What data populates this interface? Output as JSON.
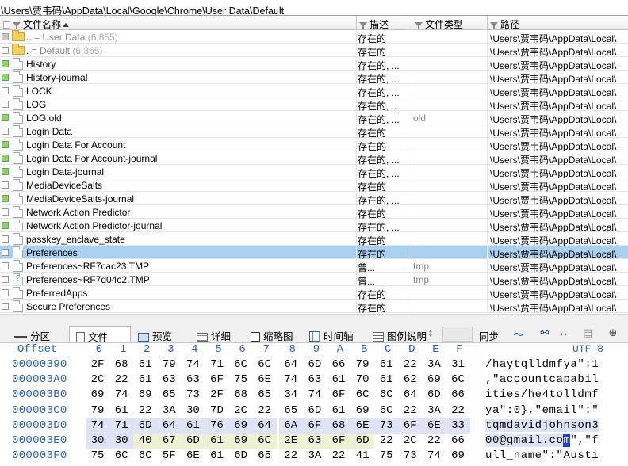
{
  "path_bar": "\\Users\\贾韦码\\AppData\\Local\\Google\\Chrome\\User Data\\Default",
  "columns": {
    "name": "文件名称",
    "desc": "描述",
    "type": "文件类型",
    "path": "路径"
  },
  "files": [
    {
      "name": "..",
      "extra": " =   User Data",
      "count": "(6,855)",
      "desc": "存在的",
      "type": "",
      "path": "\\Users\\贾韦码\\AppData\\Local\\",
      "icon": "folder",
      "mark": "gray",
      "dim": true,
      "selected": false
    },
    {
      "name": ".",
      "extra": "  =   Default",
      "count": "(6,365)",
      "desc": "存在的",
      "type": "",
      "path": "\\Users\\贾韦码\\AppData\\Local\\",
      "icon": "folder",
      "mark": "none",
      "dim": true,
      "selected": false
    },
    {
      "name": "History",
      "extra": "",
      "count": "",
      "desc": "存在的, ...",
      "type": "",
      "path": "\\Users\\贾韦码\\AppData\\Local\\",
      "icon": "file",
      "mark": "green",
      "dim": false,
      "selected": false
    },
    {
      "name": "History-journal",
      "extra": "",
      "count": "",
      "desc": "存在的, ...",
      "type": "",
      "path": "\\Users\\贾韦码\\AppData\\Local\\",
      "icon": "file",
      "mark": "green",
      "dim": false,
      "selected": false
    },
    {
      "name": "LOCK",
      "extra": "",
      "count": "",
      "desc": "存在的, ...",
      "type": "",
      "path": "\\Users\\贾韦码\\AppData\\Local\\",
      "icon": "file",
      "mark": "none",
      "dim": false,
      "selected": false
    },
    {
      "name": "LOG",
      "extra": "",
      "count": "",
      "desc": "存在的, ...",
      "type": "",
      "path": "\\Users\\贾韦码\\AppData\\Local\\",
      "icon": "file",
      "mark": "none",
      "dim": false,
      "selected": false
    },
    {
      "name": "LOG.old",
      "extra": "",
      "count": "",
      "desc": "存在的, ...",
      "type": "old",
      "path": "\\Users\\贾韦码\\AppData\\Local\\",
      "icon": "file",
      "mark": "green",
      "dim": false,
      "selected": false
    },
    {
      "name": "Login Data",
      "extra": "",
      "count": "",
      "desc": "存在的",
      "type": "",
      "path": "\\Users\\贾韦码\\AppData\\Local\\",
      "icon": "file",
      "mark": "none",
      "dim": false,
      "selected": false
    },
    {
      "name": "Login Data For Account",
      "extra": "",
      "count": "",
      "desc": "存在的",
      "type": "",
      "path": "\\Users\\贾韦码\\AppData\\Local\\",
      "icon": "file",
      "mark": "green",
      "dim": false,
      "selected": false
    },
    {
      "name": "Login Data For Account-journal",
      "extra": "",
      "count": "",
      "desc": "存在的, ...",
      "type": "",
      "path": "\\Users\\贾韦码\\AppData\\Local\\",
      "icon": "file",
      "mark": "green",
      "dim": false,
      "selected": false
    },
    {
      "name": "Login Data-journal",
      "extra": "",
      "count": "",
      "desc": "存在的, ...",
      "type": "",
      "path": "\\Users\\贾韦码\\AppData\\Local\\",
      "icon": "file",
      "mark": "green",
      "dim": false,
      "selected": false
    },
    {
      "name": "MediaDeviceSalts",
      "extra": "",
      "count": "",
      "desc": "存在的",
      "type": "",
      "path": "\\Users\\贾韦码\\AppData\\Local\\",
      "icon": "file",
      "mark": "none",
      "dim": false,
      "selected": false
    },
    {
      "name": "MediaDeviceSalts-journal",
      "extra": "",
      "count": "",
      "desc": "存在的, ...",
      "type": "",
      "path": "\\Users\\贾韦码\\AppData\\Local\\",
      "icon": "file",
      "mark": "green",
      "dim": false,
      "selected": false
    },
    {
      "name": "Network Action Predictor",
      "extra": "",
      "count": "",
      "desc": "存在的",
      "type": "",
      "path": "\\Users\\贾韦码\\AppData\\Local\\",
      "icon": "file",
      "mark": "none",
      "dim": false,
      "selected": false
    },
    {
      "name": "Network Action Predictor-journal",
      "extra": "",
      "count": "",
      "desc": "存在的, ...",
      "type": "",
      "path": "\\Users\\贾韦码\\AppData\\Local\\",
      "icon": "file",
      "mark": "green",
      "dim": false,
      "selected": false
    },
    {
      "name": "passkey_enclave_state",
      "extra": "",
      "count": "",
      "desc": "存在的",
      "type": "",
      "path": "\\Users\\贾韦码\\AppData\\Local\\",
      "icon": "file",
      "mark": "none",
      "dim": false,
      "selected": false
    },
    {
      "name": "Preferences",
      "extra": "",
      "count": "",
      "desc": "存在的",
      "type": "",
      "path": "\\Users\\贾韦码\\AppData\\Local\\",
      "icon": "file",
      "mark": "none",
      "dim": false,
      "selected": true
    },
    {
      "name": "Preferences~RF7cac23.TMP",
      "extra": "",
      "count": "",
      "desc": "曾...",
      "type": "tmp",
      "path": "\\Users\\贾韦码\\AppData\\Local\\",
      "icon": "file",
      "mark": "none",
      "dim": false,
      "selected": false
    },
    {
      "name": "Preferences~RF7d04c2.TMP",
      "extra": "",
      "count": "",
      "desc": "曾...",
      "type": "tmp",
      "path": "\\Users\\贾韦码\\AppData\\Local\\",
      "icon": "file-q",
      "mark": "none",
      "dim": false,
      "selected": false
    },
    {
      "name": "PreferredApps",
      "extra": "",
      "count": "",
      "desc": "存在的",
      "type": "",
      "path": "\\Users\\贾韦码\\AppData\\Local\\",
      "icon": "file",
      "mark": "none",
      "dim": false,
      "selected": false
    },
    {
      "name": "Secure Preferences",
      "extra": "",
      "count": "",
      "desc": "存在的",
      "type": "",
      "path": "\\Users\\贾韦码\\AppData\\Local\\",
      "icon": "file",
      "mark": "none",
      "dim": false,
      "selected": false
    }
  ],
  "tabs": [
    {
      "label": "分区",
      "icon": "partition-icon",
      "active": false
    },
    {
      "label": "文件",
      "icon": "file-icon",
      "active": true
    },
    {
      "label": "预览",
      "icon": "preview-icon",
      "active": false
    },
    {
      "label": "详细",
      "icon": "details-icon",
      "active": false
    },
    {
      "label": "缩略图",
      "icon": "thumbnail-icon",
      "active": false
    },
    {
      "label": "时间轴",
      "icon": "timeline-icon",
      "active": false
    },
    {
      "label": "图例说明",
      "icon": "legend-icon",
      "active": false
    },
    {
      "label": "同步",
      "icon": "sync-icon",
      "active": false
    }
  ],
  "hex": {
    "offset_label": "Offset",
    "encoding_label": "UTF-8",
    "columns": [
      "0",
      "1",
      "2",
      "3",
      "4",
      "5",
      "6",
      "7",
      "8",
      "9",
      "A",
      "B",
      "C",
      "D",
      "E",
      "F"
    ],
    "rows": [
      {
        "offset": "00000390",
        "bytes": [
          "2F",
          "68",
          "61",
          "79",
          "74",
          "71",
          "6C",
          "6C",
          "64",
          "6D",
          "66",
          "79",
          "61",
          "22",
          "3A",
          "31"
        ],
        "ascii": "/haytqlldmfya\":1"
      },
      {
        "offset": "000003A0",
        "bytes": [
          "2C",
          "22",
          "61",
          "63",
          "63",
          "6F",
          "75",
          "6E",
          "74",
          "63",
          "61",
          "70",
          "61",
          "62",
          "69",
          "6C"
        ],
        "ascii": ",\"accountcapabil"
      },
      {
        "offset": "000003B0",
        "bytes": [
          "69",
          "74",
          "69",
          "65",
          "73",
          "2F",
          "68",
          "65",
          "34",
          "74",
          "6F",
          "6C",
          "6C",
          "64",
          "6D",
          "66"
        ],
        "ascii": "ities/he4tolldmf"
      },
      {
        "offset": "000003C0",
        "bytes": [
          "79",
          "61",
          "22",
          "3A",
          "30",
          "7D",
          "2C",
          "22",
          "65",
          "6D",
          "61",
          "69",
          "6C",
          "22",
          "3A",
          "22"
        ],
        "ascii": "ya\":0},\"email\":\""
      },
      {
        "offset": "000003D0",
        "bytes": [
          "74",
          "71",
          "6D",
          "64",
          "61",
          "76",
          "69",
          "64",
          "6A",
          "6F",
          "68",
          "6E",
          "73",
          "6F",
          "6E",
          "33"
        ],
        "ascii": "tqmdavidjohnson3"
      },
      {
        "offset": "000003E0",
        "bytes": [
          "30",
          "30",
          "40",
          "67",
          "6D",
          "61",
          "69",
          "6C",
          "2E",
          "63",
          "6F",
          "6D",
          "22",
          "2C",
          "22",
          "66"
        ],
        "ascii": "00@gmail.com\",\"f"
      },
      {
        "offset": "000003F0",
        "bytes": [
          "75",
          "6C",
          "6C",
          "5F",
          "6E",
          "61",
          "6D",
          "65",
          "22",
          "3A",
          "22",
          "41",
          "75",
          "73",
          "74",
          "69"
        ],
        "ascii": "ull_name\":\"Austi"
      }
    ]
  },
  "colors": {
    "selection": "#a9d0ef",
    "hex_label": "#2a5ec4",
    "highlight_a": "#dfe3f6",
    "highlight_b": "#eff1d5",
    "caret": "#1f3fd4"
  }
}
